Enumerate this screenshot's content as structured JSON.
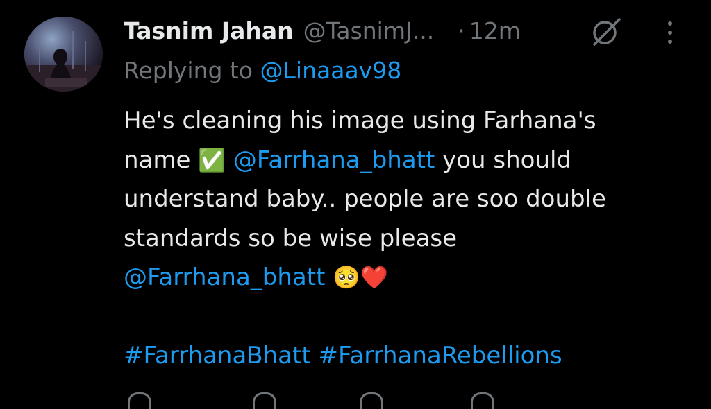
{
  "tweet": {
    "author": {
      "display_name": "Tasnim Jahan",
      "handle": "@TasnimJ..."
    },
    "separator": "·",
    "timestamp": "12m",
    "replying_to_prefix": "Replying to ",
    "replying_to_handle": "@Linaaav98",
    "text": {
      "line1": "He's cleaning his image using Farhana's",
      "line2_start": "name ",
      "line2_emoji": "✅",
      "line2_mention": "@Farrhana_bhatt",
      "line2_end": " you should",
      "line3": "understand baby.. people are soo double",
      "line4": "standards so be wise please",
      "line5_mention": "@Farrhana_bhatt",
      "line5_emoji": "🥺❤️"
    },
    "hashtags": [
      "#FarrhanaBhatt",
      "#FarrhanaRebellions"
    ]
  },
  "icons": {
    "grok": "grok-icon",
    "more": "more-options-icon",
    "verified_check": "check-mark-emoji"
  },
  "colors": {
    "background": "#000000",
    "text": "#e7e9ea",
    "secondary": "#71767b",
    "link": "#1d9bf0"
  }
}
